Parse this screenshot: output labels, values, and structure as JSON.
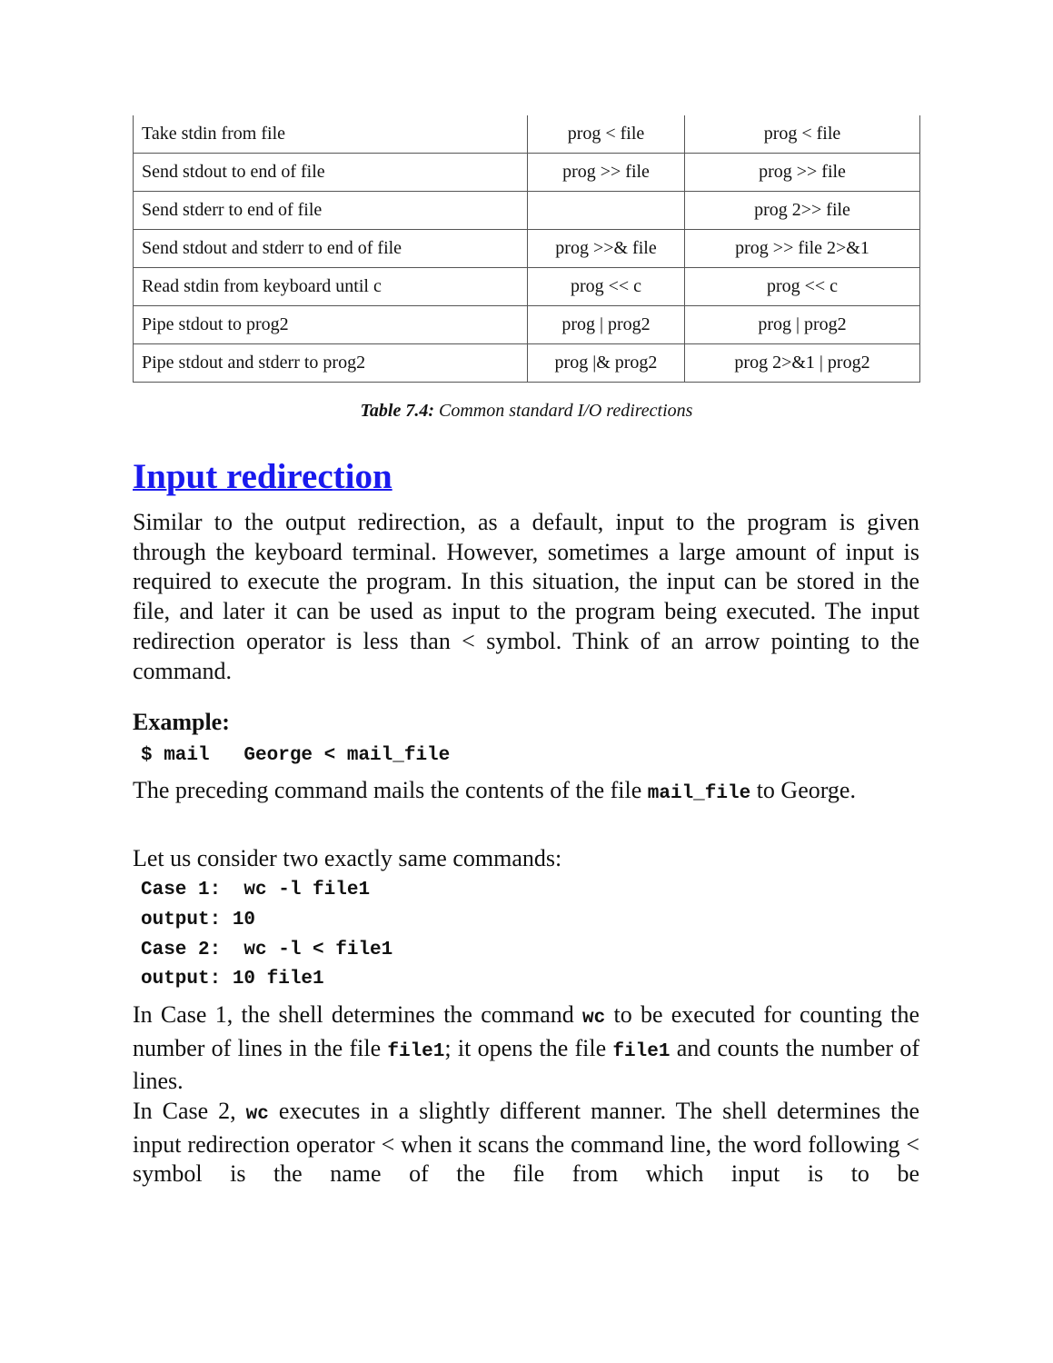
{
  "table": {
    "rows": [
      [
        "Take stdin from file",
        "prog < file",
        "prog < file"
      ],
      [
        "Send stdout to end of file",
        "prog >> file",
        "prog >> file"
      ],
      [
        "Send stderr to end of file",
        "",
        "prog 2>> file"
      ],
      [
        "Send stdout and stderr to end of file",
        "prog >>& file",
        "prog >> file 2>&1"
      ],
      [
        "Read stdin from keyboard until c",
        "prog << c",
        "prog << c"
      ],
      [
        "Pipe stdout to prog2",
        "prog | prog2",
        "prog | prog2"
      ],
      [
        "Pipe stdout and stderr to prog2",
        "prog |& prog2",
        "prog 2>&1 | prog2"
      ]
    ],
    "caption_label": "Table 7.4:",
    "caption_text": " Common standard I/O redirections"
  },
  "section": {
    "heading": "Input redirection",
    "heading_color": "#1a1aee",
    "para1": "Similar to the output redirection, as a default, input to the program is given through the keyboard terminal. However, sometimes a large amount of input is required to execute the program. In this situation, the input can be stored in the file, and later it can be used as input to the program being executed. The input redirection operator is less than < symbol. Think of an arrow pointing to the command.",
    "example_label": "Example:",
    "example_code": "$ mail   George < mail_file",
    "para2_a": "The preceding command mails the contents of the file ",
    "para2_code": "mail_file",
    "para2_b": " to George.",
    "para3": "Let us consider two exactly same commands:",
    "cases": [
      "Case 1:  wc -l file1",
      "output: 10",
      "Case 2:  wc -l < file1",
      "output: 10 file1"
    ],
    "para4_a": "In Case 1, the shell determines the command ",
    "para4_code1": "wc",
    "para4_b": " to be executed for counting the number of lines in the file ",
    "para4_code2": "file1",
    "para4_c": "; it opens the file ",
    "para4_code3": "file1",
    "para4_d": " and counts the number of lines.",
    "para5_a": "In Case 2, ",
    "para5_code": "wc",
    "para5_b": " executes in a slightly different manner. The shell determines the input redirection operator < when it scans the command line, the word following < symbol is the name of the file from which input is to be"
  }
}
